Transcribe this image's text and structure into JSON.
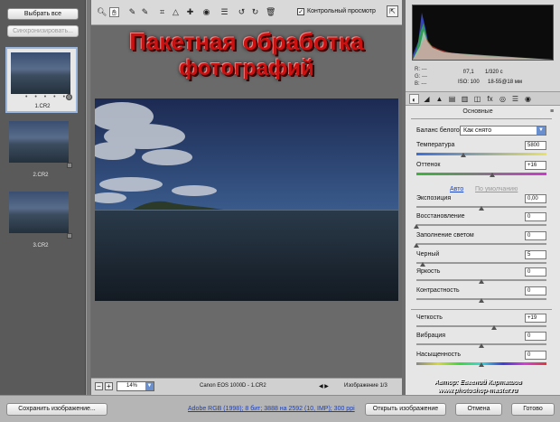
{
  "filmstrip": {
    "select_all": "Выбрать все",
    "synchronize": "Синхронизировать...",
    "items": [
      {
        "name": "1.CR2",
        "rating": "• • • • •"
      },
      {
        "name": "2.CR2"
      },
      {
        "name": "3.CR2"
      }
    ]
  },
  "toolbar": {
    "tools": [
      "zoom-icon",
      "hand-icon",
      "white-balance-icon",
      "color-sampler-icon",
      "crop-icon",
      "straighten-icon",
      "retouch-icon",
      "red-eye-icon",
      "preferences-icon",
      "rotate-left-icon",
      "rotate-right-icon",
      "trash-icon"
    ],
    "preview_label": "Контрольный просмотр",
    "preview_checked": "✓"
  },
  "overlay": {
    "line1": "Пакетная обработка",
    "line2": "фотографий"
  },
  "statusbar": {
    "zoom": "14%",
    "camera": "Canon EOS 1000D  -  1.CR2",
    "nav": "◀  ▶",
    "image_count": "Изображение 1/3"
  },
  "histogram": {
    "r": "R:   ---",
    "g": "G:   ---",
    "b": "B:   ---",
    "aperture": "f/7,1",
    "shutter": "1/320 с",
    "iso": "ISO: 100",
    "lens": "18-55@18 мм"
  },
  "panel": {
    "title": "Основные",
    "menu": "≡",
    "white_balance_label": "Баланс белого:",
    "white_balance_value": "Как снято",
    "auto": "Авто",
    "default": "По умолчанию",
    "sliders": [
      {
        "label": "Температура",
        "value": "5800",
        "position": 0.36
      },
      {
        "label": "Оттенок",
        "value": "+16",
        "position": 0.58
      },
      {
        "label": "Экспозиция",
        "value": "0,00",
        "position": 0.5
      },
      {
        "label": "Восстановление",
        "value": "0",
        "position": 0.0
      },
      {
        "label": "Заполнение светом",
        "value": "0",
        "position": 0.0
      },
      {
        "label": "Черный",
        "value": "5",
        "position": 0.05
      },
      {
        "label": "Яркость",
        "value": "0",
        "position": 0.5
      },
      {
        "label": "Контрастность",
        "value": "0",
        "position": 0.5
      },
      {
        "label": "Четкость",
        "value": "+19",
        "position": 0.6
      },
      {
        "label": "Вибрация",
        "value": "0",
        "position": 0.5
      },
      {
        "label": "Насыщенность",
        "value": "0",
        "position": 0.5
      }
    ]
  },
  "watermark": {
    "author": "Автор: Евгений Карташов",
    "site": "www.photoshop-master.ru"
  },
  "bottom": {
    "save": "Сохранить изображение...",
    "workflow": "Adobe RGB (1998); 8 бит; 3888 на 2592 (10, IMP); 300 ppi",
    "open": "Открыть изображение",
    "cancel": "Отмена",
    "done": "Готово"
  }
}
